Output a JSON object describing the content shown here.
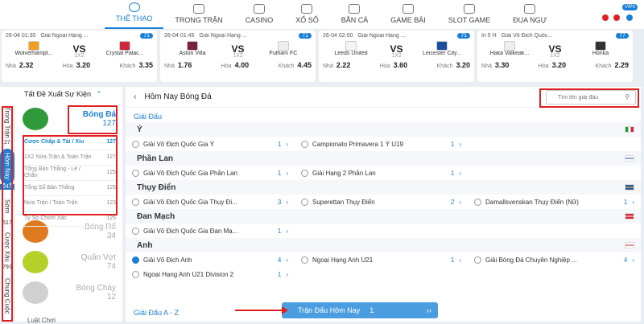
{
  "nav": {
    "items": [
      "THỂ THAO",
      "TRONG TRẬN",
      "CASINO",
      "XỔ SỐ",
      "BẮN CÁ",
      "GAME BÀI",
      "SLOT GAME",
      "ĐUA NGỰ"
    ],
    "vip": "VIP0"
  },
  "matches": [
    {
      "time": "26-04 01:30",
      "league": "Giải Ngoại Hạng ...",
      "count": "71",
      "home": "Wolverhampt...",
      "away": "Crystal Palac...",
      "market": "1X2",
      "odds": [
        {
          "l": "Nhà",
          "v": "2.32"
        },
        {
          "l": "Hòa",
          "v": "3.20"
        },
        {
          "l": "Khách",
          "v": "3.35"
        }
      ],
      "home_color": "#f0a020",
      "away_color": "#d0283c"
    },
    {
      "time": "26-04 01:45",
      "league": "Giải Ngoại Hạng ...",
      "count": "71",
      "home": "Aston Villa",
      "away": "Fulham FC",
      "market": "1X2",
      "odds": [
        {
          "l": "Nhà",
          "v": "1.76"
        },
        {
          "l": "Hòa",
          "v": "4.00"
        },
        {
          "l": "Khách",
          "v": "4.45"
        }
      ],
      "home_color": "#7a1f3d",
      "away_color": "#eeeeee"
    },
    {
      "time": "26-04 02:00",
      "league": "Giải Ngoại Hạng ...",
      "count": "71",
      "home": "Leeds United",
      "away": "Leicester City...",
      "market": "1X2",
      "odds": [
        {
          "l": "Nhà",
          "v": "2.22"
        },
        {
          "l": "Hòa",
          "v": "3.60"
        },
        {
          "l": "Khách",
          "v": "3.20"
        }
      ],
      "home_color": "#f4f4f4",
      "away_color": "#1d4ea0"
    },
    {
      "time": "In 5 H",
      "league": "Giải Vô Địch Quốc...",
      "count": "77",
      "home": "Haka Valkeak...",
      "away": "Honka",
      "market": "1X2",
      "odds": [
        {
          "l": "Nhà",
          "v": "3.30"
        },
        {
          "l": "Hòa",
          "v": "3.20"
        },
        {
          "l": "Khách",
          "v": "2.29"
        }
      ],
      "home_color": "#eeeeee",
      "away_color": "#333333"
    }
  ],
  "sidebar": {
    "title": "Tất Đề Xuất Sự Kiện",
    "tabs": [
      {
        "label": "Trong Trận",
        "count": "27"
      },
      {
        "label": "Hôm Nay",
        "count": "247"
      },
      {
        "label": "Sớm",
        "count": "517"
      },
      {
        "label": "Cược Xâu",
        "count": "791"
      },
      {
        "label": "Chung Cuộc",
        "count": ""
      }
    ],
    "sports": [
      {
        "name": "Bóng Đá",
        "count": "127",
        "color": "#2e9a3a"
      },
      {
        "name": "Bóng Rổ",
        "count": "34",
        "color": "#e07a20"
      },
      {
        "name": "Quần Vợt",
        "count": "74",
        "color": "#b6d02a"
      },
      {
        "name": "Bóng Chày",
        "count": "12",
        "color": "#d0d0d0"
      }
    ],
    "bets": [
      {
        "label": "Cược Chấp & Tài / Xỉu",
        "count": "127"
      },
      {
        "label": "1X2 Nửa Trận & Toàn Trận",
        "count": "127"
      },
      {
        "label": "Tổng Bàn Thắng - Lẻ / Chẵn",
        "count": "125"
      },
      {
        "label": "Tổng Số Bàn Thắng",
        "count": "125"
      },
      {
        "label": "Nửa Trận / Toàn Trận",
        "count": "123"
      },
      {
        "label": "Tỷ Số Chính Xác",
        "count": "125"
      }
    ],
    "more": "Luật Chơi"
  },
  "main": {
    "title": "Hôm Nay Bóng Đá",
    "search_placeholder": "Tìm tên giải đấu",
    "section": "Giải Đấu",
    "countries": [
      {
        "name": "Ý",
        "leagues": [
          {
            "name": "Giải Vô Địch Quốc Gia Ý",
            "count": "1",
            "checked": false
          },
          {
            "name": "Campionato Primavera 1 Ý U19",
            "count": "1",
            "checked": false
          }
        ]
      },
      {
        "name": "Phần Lan",
        "leagues": [
          {
            "name": "Giải Vô Địch Quốc Gia Phần Lan",
            "count": "1",
            "checked": false
          },
          {
            "name": "Giải Hạng 2 Phần Lan",
            "count": "1",
            "checked": false
          }
        ]
      },
      {
        "name": "Thụy Điển",
        "leagues": [
          {
            "name": "Giải Vô Địch Quốc Gia Thụy Đi...",
            "count": "3",
            "checked": false
          },
          {
            "name": "Superettan Thụy Điển",
            "count": "2",
            "checked": false
          },
          {
            "name": "Damallsvenskan Thụy Điển (Nữ)",
            "count": "1",
            "checked": false
          }
        ]
      },
      {
        "name": "Đan Mạch",
        "leagues": [
          {
            "name": "Giải Vô Địch Quốc Gia Đan Mạ...",
            "count": "1",
            "checked": false
          }
        ]
      },
      {
        "name": "Anh",
        "leagues": [
          {
            "name": "Giải Vô Địch Anh",
            "count": "4",
            "checked": true
          },
          {
            "name": "Ngoại Hạng Anh U21",
            "count": "1",
            "checked": false
          },
          {
            "name": "Giải Bóng Đá Chuyên Nghiệp ...",
            "count": "4",
            "checked": false
          }
        ]
      }
    ],
    "extra_league": {
      "name": "Ngoại Hạng Anh U21 Division 2",
      "count": "1"
    },
    "az_label": "Giải Đấu A - Z",
    "today_label": "Trận Đấu Hôm Nay",
    "today_count": "1"
  }
}
